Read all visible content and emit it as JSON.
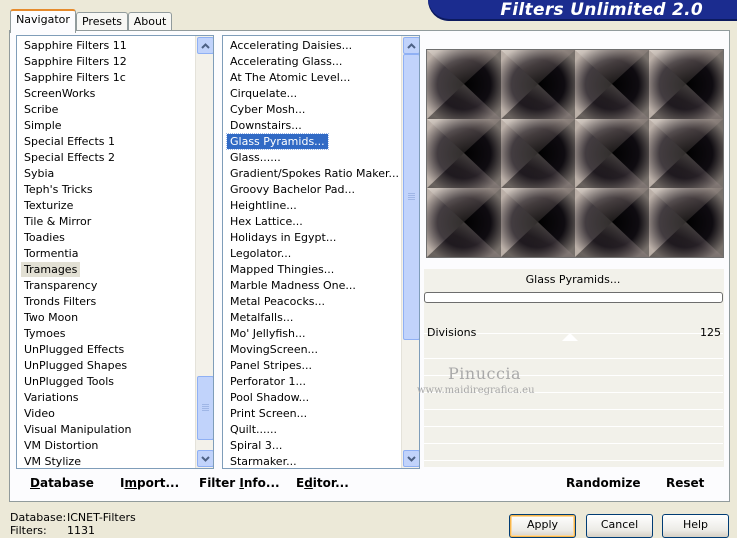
{
  "brand": {
    "title": "Filters Unlimited 2.0"
  },
  "tabs": [
    {
      "label": "Navigator",
      "active": true
    },
    {
      "label": "Presets",
      "active": false
    },
    {
      "label": "About",
      "active": false
    }
  ],
  "categories": {
    "items": [
      "Sapphire Filters 11",
      "Sapphire Filters 12",
      "Sapphire Filters 1c",
      "ScreenWorks",
      "Scribe",
      "Simple",
      "Special Effects 1",
      "Special Effects 2",
      "Sybia",
      "Teph's Tricks",
      "Texturize",
      "Tile & Mirror",
      "Toadies",
      "Tormentia",
      "Tramages",
      "Transparency",
      "Tronds Filters",
      "Two Moon",
      "Tymoes",
      "UnPlugged Effects",
      "UnPlugged Shapes",
      "UnPlugged Tools",
      "Variations",
      "Video",
      "Visual Manipulation",
      "VM Distortion",
      "VM Stylize"
    ],
    "highlighted": "Tramages"
  },
  "filters": {
    "items": [
      "Accelerating Daisies...",
      "Accelerating Glass...",
      "At The Atomic Level...",
      "Cirquelate...",
      "Cyber Mosh...",
      "Downstairs...",
      "Glass Pyramids...",
      "Glass......",
      "Gradient/Spokes Ratio Maker...",
      "Groovy Bachelor Pad...",
      "Heightline...",
      "Hex Lattice...",
      "Holidays in Egypt...",
      "Legolator...",
      "Mapped Thingies...",
      "Marble Madness One...",
      "Metal Peacocks...",
      "Metalfalls...",
      "Mo' Jellyfish...",
      "MovingScreen...",
      "Panel Stripes...",
      "Perforator 1...",
      "Pool Shadow...",
      "Print Screen...",
      "Quilt......",
      "Spiral 3...",
      "Starmaker..."
    ],
    "selected": "Glass Pyramids..."
  },
  "preview": {
    "filter_name": "Glass Pyramids...",
    "progress": 0
  },
  "params": [
    {
      "name": "Divisions",
      "value": "125"
    }
  ],
  "watermark": {
    "line1": "Pinuccia",
    "line2": "www.maidiregrafica.eu"
  },
  "actions": {
    "database_pre": "D",
    "database_rest": "atabase",
    "import_pre": "I",
    "import_mid": "m",
    "import_rest": "port...",
    "filter_info_pre": "Filter ",
    "filter_info_u": "I",
    "filter_info_rest": "nfo...",
    "editor_pre": "E",
    "editor_mid": "d",
    "editor_rest": "itor...",
    "randomize": "Randomize",
    "reset": "Reset"
  },
  "footer": {
    "database_label": "Database:",
    "database_value": "ICNET-Filters",
    "filters_label": "Filters:",
    "filters_value": "1131",
    "apply": "Apply",
    "cancel": "Cancel",
    "help": "Help"
  }
}
